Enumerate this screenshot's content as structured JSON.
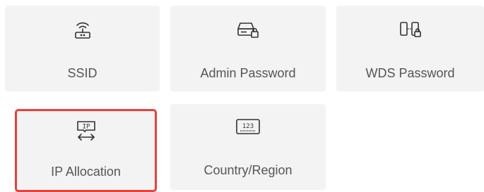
{
  "tiles": [
    {
      "id": "ssid",
      "label": "SSID",
      "icon": "router-wifi-icon",
      "selected": false
    },
    {
      "id": "admin_password",
      "label": "Admin Password",
      "icon": "device-lock-icon",
      "selected": false
    },
    {
      "id": "wds_password",
      "label": "WDS Password",
      "icon": "bridge-lock-icon",
      "selected": false
    },
    {
      "id": "ip_allocation",
      "label": "IP Allocation",
      "icon": "ip-exchange-icon",
      "selected": true
    },
    {
      "id": "country_region",
      "label": "Country/Region",
      "icon": "region-code-icon",
      "selected": false
    }
  ],
  "icon_text": {
    "ip": "IP",
    "region_code": "123"
  },
  "colors": {
    "tile_background": "#f3f3f3",
    "selected_border": "#e8413c",
    "label_text": "#555555",
    "icon_stroke": "#333333"
  }
}
